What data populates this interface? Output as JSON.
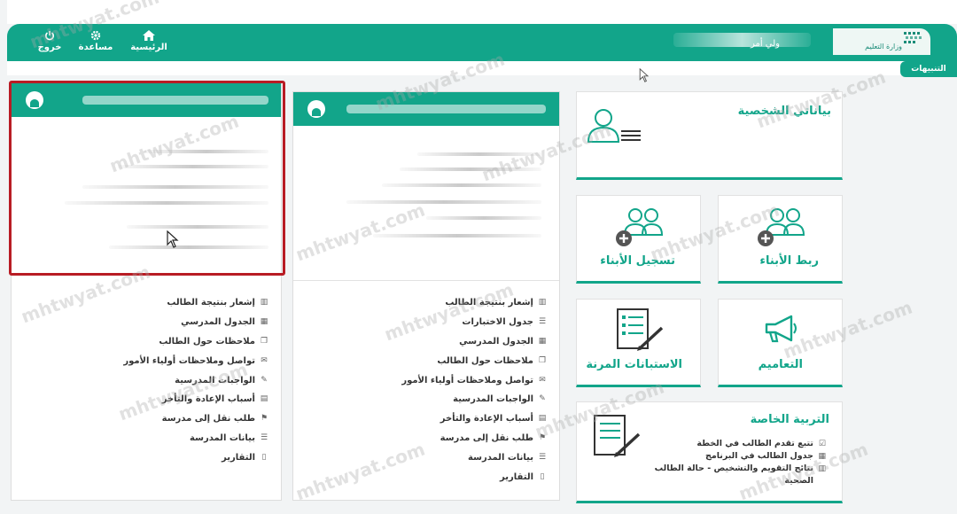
{
  "header": {
    "nav": [
      {
        "label": "الرئيسية",
        "icon": "home-icon"
      },
      {
        "label": "مساعدة",
        "icon": "gear-icon"
      },
      {
        "label": "خروج",
        "icon": "power-icon"
      }
    ],
    "user_name_visible": "ولي أمر",
    "ministry_logo_text": "وزارة التعليم"
  },
  "notifications": {
    "tab_label": "التنبيهات"
  },
  "cards": {
    "personal": {
      "title": "بياناتي الشخصية",
      "icon": "profile-card-icon"
    },
    "link_children": {
      "title": "ربط الأبناء",
      "icon": "add-users-icon"
    },
    "register_children": {
      "title": "تسجيل الأبناء",
      "icon": "add-users-icon"
    },
    "circulars": {
      "title": "التعاميم",
      "icon": "megaphone-icon"
    },
    "surveys": {
      "title": "الاستبانات المرنة",
      "icon": "form-pen-icon"
    },
    "special_education": {
      "title": "التربية الخاصة",
      "icon": "form-pen-icon",
      "items": [
        {
          "label": "تتبع تقدم الطالب في الخطة",
          "icon": "check-icon"
        },
        {
          "label": "جدول الطالب في البرنامج",
          "icon": "calendar-icon"
        },
        {
          "label": "نتائج التقويم والتشخيص - حالة الطالب الصحية",
          "icon": "chart-icon"
        }
      ]
    }
  },
  "student_panel_1": {
    "menu": [
      {
        "label": "إشعار بنتيجة الطالب",
        "icon": "chart-icon"
      },
      {
        "label": "جدول الاختبارات",
        "icon": "list-icon"
      },
      {
        "label": "الجدول المدرسي",
        "icon": "calendar-icon"
      },
      {
        "label": "ملاحظات حول الطالب",
        "icon": "notes-icon"
      },
      {
        "label": "تواصل وملاحظات أولياء الأمور",
        "icon": "chat-icon"
      },
      {
        "label": "الواجبات المدرسية",
        "icon": "edit-icon"
      },
      {
        "label": "أسباب الإعادة والتأخر",
        "icon": "table-icon"
      },
      {
        "label": "طلب نقل إلى مدرسة",
        "icon": "flag-icon"
      },
      {
        "label": "بيانات المدرسة",
        "icon": "list-icon"
      },
      {
        "label": "التقارير",
        "icon": "file-icon"
      }
    ]
  },
  "student_panel_2": {
    "menu": [
      {
        "label": "إشعار بنتيجة الطالب",
        "icon": "chart-icon"
      },
      {
        "label": "الجدول المدرسي",
        "icon": "calendar-icon"
      },
      {
        "label": "ملاحظات حول الطالب",
        "icon": "notes-icon"
      },
      {
        "label": "تواصل وملاحظات أولياء الأمور",
        "icon": "chat-icon"
      },
      {
        "label": "الواجبات المدرسية",
        "icon": "edit-icon"
      },
      {
        "label": "أسباب الإعادة والتأخر",
        "icon": "table-icon"
      },
      {
        "label": "طلب نقل إلى مدرسة",
        "icon": "flag-icon"
      },
      {
        "label": "بيانات المدرسة",
        "icon": "list-icon"
      },
      {
        "label": "التقارير",
        "icon": "file-icon"
      }
    ]
  },
  "watermark_text": "mhtwyat.com",
  "colors": {
    "brand": "#12a58a",
    "highlight": "#b81c24"
  }
}
